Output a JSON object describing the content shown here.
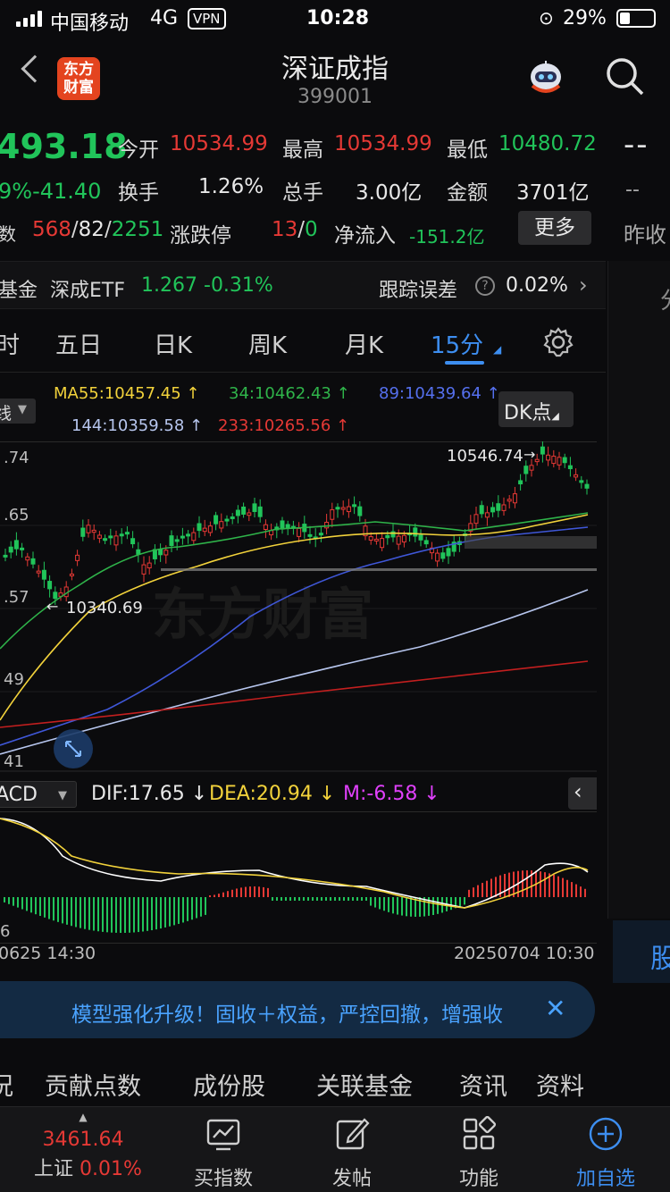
{
  "status_bar": {
    "carrier": "中国移动",
    "network": "4G",
    "vpn": "VPN",
    "time": "10:28",
    "battery": "29%"
  },
  "header": {
    "title": "深证成指",
    "code": "399001",
    "logo_text": "东方财富"
  },
  "quote": {
    "price": "493.18",
    "change_pct_fragment": "9%",
    "change": "-41.40",
    "open_label": "今开",
    "open": "10534.99",
    "high_label": "最高",
    "high": "10534.99",
    "low_label": "最低",
    "low": "10480.72",
    "turnover_label": "换手",
    "turnover": "1.26%",
    "volume_label": "总手",
    "volume": "3.00亿",
    "amount_label": "金额",
    "amount": "3701亿",
    "family_label": "家数",
    "up_count": "568",
    "flat_count": "82",
    "down_count": "2251",
    "limit_label": "涨跌停",
    "limit_up": "13",
    "limit_down": "0",
    "inflow_label": "净流入",
    "inflow": "-151.2亿",
    "more_button": "更多",
    "right_dashes": "--",
    "right_dash2": "--",
    "right_label": "昨收"
  },
  "fund_row": {
    "prefix": "基金",
    "name": "深成ETF",
    "price": "1.267",
    "change": "-0.31%",
    "tracking_label": "跟踪误差",
    "tracking_value": "0.02%"
  },
  "tabs": [
    {
      "label": "时"
    },
    {
      "label": "五日"
    },
    {
      "label": "日K"
    },
    {
      "label": "周K"
    },
    {
      "label": "月K"
    },
    {
      "label": "15分"
    }
  ],
  "ma_legend": {
    "select_label": "线",
    "ma55": "MA55:10457.45 ↑",
    "ma34": "34:10462.43 ↑",
    "ma89": "89:10439.64 ↑",
    "ma144": "144:10359.58 ↑",
    "ma233": "233:10265.56 ↑",
    "dk_button": "DK点"
  },
  "chart_axis": {
    "y_labels": [
      ".74",
      ".65",
      ".57",
      "49",
      "41"
    ],
    "high_marker": "10546.74",
    "low_marker": "10340.69",
    "watermark": "东方财富"
  },
  "macd": {
    "select_label": "ACD",
    "dif": "DIF:17.65 ↓",
    "dea": "DEA:20.94 ↓",
    "m": "M:-6.58 ↓",
    "y_label": "6"
  },
  "time_axis": {
    "start": "0625 14:30",
    "end": "20250704 10:30"
  },
  "banner": {
    "text": "模型强化升级！固收＋权益，严控回撤，增强收"
  },
  "subtabs": [
    "况",
    "贡献点数",
    "成份股",
    "关联基金",
    "资讯",
    "资料"
  ],
  "right_panel": {
    "top_char": "分",
    "side_char": "股"
  },
  "bottom_bar": {
    "index_price": "3461.64",
    "index_name": "上证",
    "index_change": "0.01%",
    "buy_index": "买指数",
    "post": "发帖",
    "functions": "功能",
    "add_watch": "加自选"
  },
  "colors": {
    "up": "#e53935",
    "down": "#21c45a",
    "accent": "#3d8ef0",
    "ma55": "#f2d23b",
    "ma34": "#2fb44a",
    "ma89": "#3f57d8",
    "ma144": "#b7c6ee",
    "ma233": "#c31f1f"
  }
}
